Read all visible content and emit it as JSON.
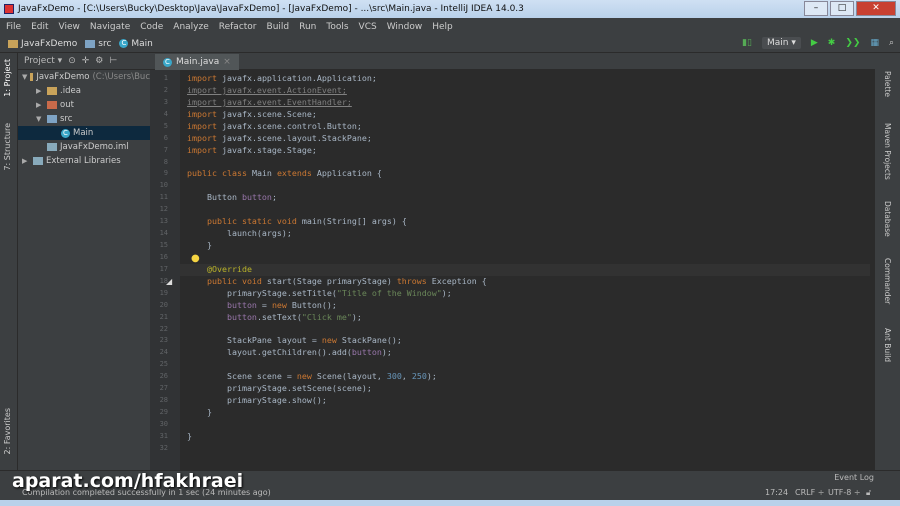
{
  "window": {
    "title": "JavaFxDemo - [C:\\Users\\Bucky\\Desktop\\Java\\JavaFxDemo] - [JavaFxDemo] - ...\\src\\Main.java - IntelliJ IDEA 14.0.3",
    "buttons": [
      "–",
      "□",
      "✕"
    ]
  },
  "menu": [
    "File",
    "Edit",
    "View",
    "Navigate",
    "Code",
    "Analyze",
    "Refactor",
    "Build",
    "Run",
    "Tools",
    "VCS",
    "Window",
    "Help"
  ],
  "breadcrumbs": [
    "JavaFxDemo",
    "src",
    "Main"
  ],
  "run_config": "Main",
  "left_tabs": [
    "1: Project",
    "7: Structure",
    "2: Favorites"
  ],
  "project": {
    "dropdown": "Project",
    "tree": [
      {
        "label": "JavaFxDemo",
        "hint": "(C:\\Users\\Buc",
        "depth": 0,
        "icon": "folder-module-icon",
        "exp": "▼"
      },
      {
        "label": ".idea",
        "depth": 1,
        "icon": "folder-icon",
        "exp": "▶"
      },
      {
        "label": "out",
        "depth": 1,
        "icon": "folder-orange-icon",
        "exp": "▶"
      },
      {
        "label": "src",
        "depth": 1,
        "icon": "folder-source-icon",
        "exp": "▼"
      },
      {
        "label": "Main",
        "depth": 2,
        "icon": "class-icon",
        "exp": "",
        "selected": true
      },
      {
        "label": "JavaFxDemo.iml",
        "depth": 1,
        "icon": "iml-file-icon",
        "exp": ""
      },
      {
        "label": "External Libraries",
        "depth": 0,
        "icon": "library-icon",
        "exp": "▶"
      }
    ]
  },
  "editor_tab": "Main.java",
  "code": [
    [
      [
        "import",
        "k"
      ],
      [
        " javafx.application.Application;",
        ""
      ]
    ],
    [
      [
        "import javafx.event.ActionEvent;",
        "g"
      ]
    ],
    [
      [
        "import javafx.event.EventHandler;",
        "g"
      ]
    ],
    [
      [
        "import",
        "k"
      ],
      [
        " javafx.scene.Scene;",
        ""
      ]
    ],
    [
      [
        "import",
        "k"
      ],
      [
        " javafx.scene.control.Button;",
        ""
      ]
    ],
    [
      [
        "import",
        "k"
      ],
      [
        " javafx.scene.layout.StackPane;",
        ""
      ]
    ],
    [
      [
        "import",
        "k"
      ],
      [
        " javafx.stage.Stage;",
        ""
      ]
    ],
    [],
    [
      [
        "public class",
        "k"
      ],
      [
        " Main ",
        ""
      ],
      [
        "extends",
        "k"
      ],
      [
        " Application {",
        ""
      ]
    ],
    [],
    [
      [
        "    Button ",
        ""
      ],
      [
        "button",
        "f"
      ],
      [
        ";",
        ""
      ]
    ],
    [],
    [
      [
        "    public static void",
        "k"
      ],
      [
        " main",
        ""
      ],
      [
        "(String[] args) {",
        ""
      ]
    ],
    [
      [
        "        launch(args);",
        ""
      ]
    ],
    [
      [
        "    }",
        ""
      ]
    ],
    [],
    [
      [
        "    @Override",
        "a"
      ]
    ],
    [
      [
        "    public void",
        "k"
      ],
      [
        " start(Stage primaryStage) ",
        ""
      ],
      [
        "throws",
        "k"
      ],
      [
        " Exception {",
        ""
      ]
    ],
    [
      [
        "        primaryStage.setTitle(",
        ""
      ],
      [
        "\"Title of the Window\"",
        "s"
      ],
      [
        ");",
        ""
      ]
    ],
    [
      [
        "        button",
        "f"
      ],
      [
        " = ",
        ""
      ],
      [
        "new",
        "k"
      ],
      [
        " Button();",
        ""
      ]
    ],
    [
      [
        "        button",
        "f"
      ],
      [
        ".setText(",
        ""
      ],
      [
        "\"Click me\"",
        "s"
      ],
      [
        ");",
        ""
      ]
    ],
    [],
    [
      [
        "        StackPane layout = ",
        ""
      ],
      [
        "new",
        "k"
      ],
      [
        " StackPane();",
        ""
      ]
    ],
    [
      [
        "        layout.getChildren().add(",
        ""
      ],
      [
        "button",
        "f"
      ],
      [
        ");",
        ""
      ]
    ],
    [],
    [
      [
        "        Scene scene = ",
        ""
      ],
      [
        "new",
        "k"
      ],
      [
        " Scene(layout, ",
        ""
      ],
      [
        "300",
        "n"
      ],
      [
        ", ",
        ""
      ],
      [
        "250",
        "n"
      ],
      [
        ");",
        ""
      ]
    ],
    [
      [
        "        primaryStage.setScene(scene);",
        ""
      ]
    ],
    [
      [
        "        primaryStage.show();",
        ""
      ]
    ],
    [
      [
        "    }",
        ""
      ]
    ],
    [],
    [
      [
        "}",
        ""
      ]
    ],
    []
  ],
  "right_tabs": [
    "Palette",
    "Maven Projects",
    "Database",
    "Commander",
    "Ant Build"
  ],
  "event_log": "Event Log",
  "status": {
    "message": "Compilation completed successfully in 1 sec (24 minutes ago)",
    "position": "17:24",
    "line_sep": "CRLF ÷",
    "encoding": "UTF-8 ÷"
  },
  "watermark": "aparat.com/hfakhraei"
}
